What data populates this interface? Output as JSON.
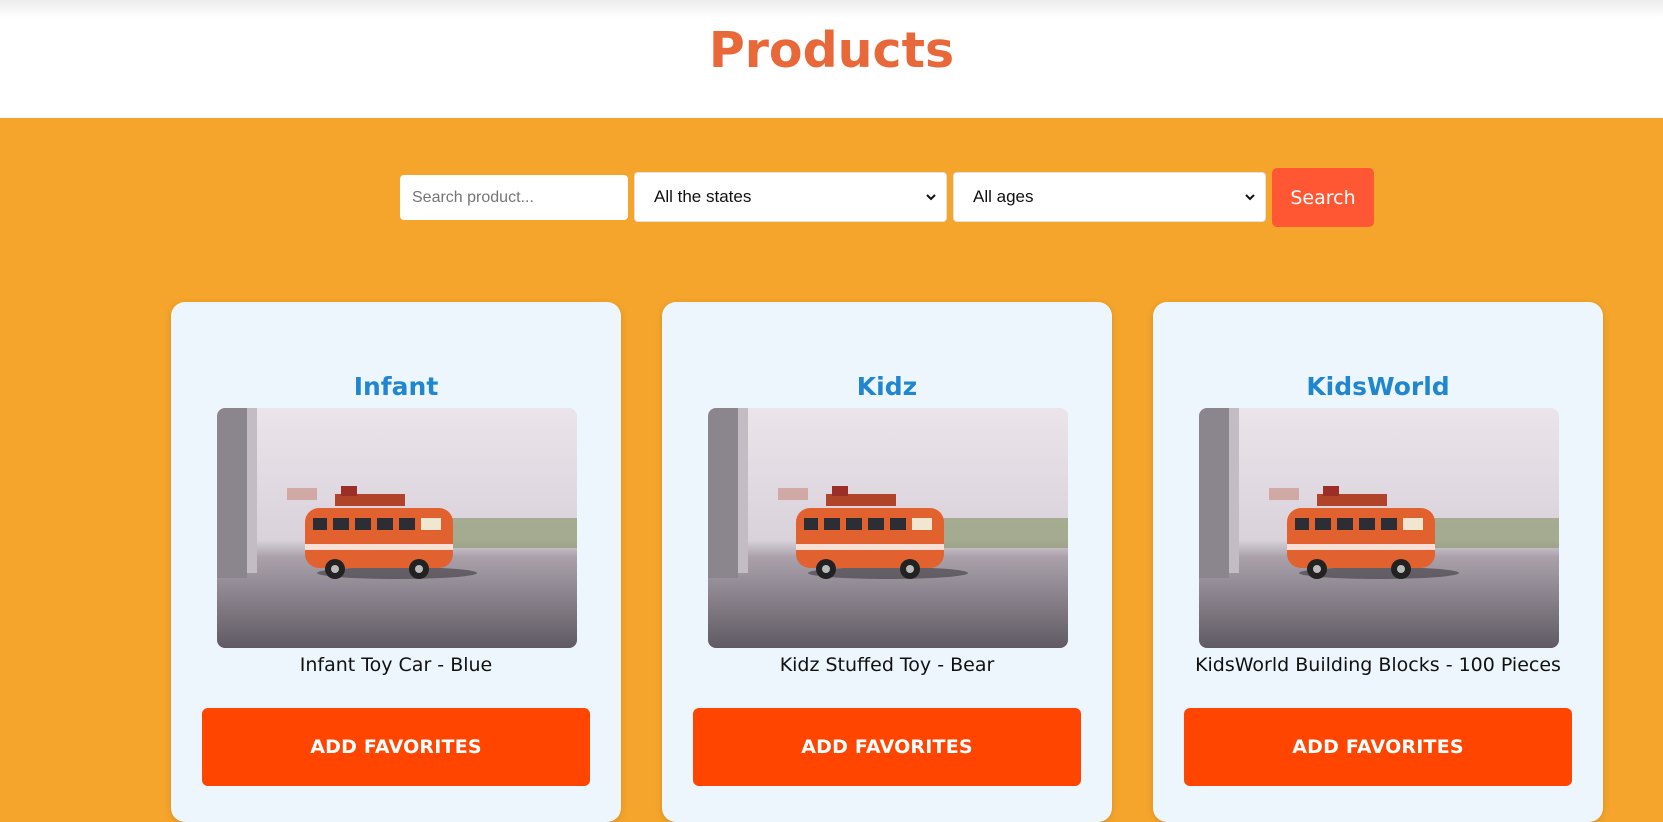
{
  "header": {
    "title": "Products"
  },
  "filters": {
    "search_placeholder": "Search product...",
    "state_selected": "All the states",
    "age_selected": "All ages",
    "search_label": "Search"
  },
  "products": [
    {
      "brand": "Infant",
      "name": "Infant Toy Car - Blue",
      "button_label": "ADD FAVORITES"
    },
    {
      "brand": "Kidz",
      "name": "Kidz Stuffed Toy - Bear",
      "button_label": "ADD FAVORITES"
    },
    {
      "brand": "KidsWorld",
      "name": "KidsWorld Building Blocks - 100 Pieces",
      "button_label": "ADD FAVORITES"
    }
  ],
  "colors": {
    "page_background": "#f5a52b",
    "title": "#e8683a",
    "brand": "#1f86cf",
    "search_button": "#ff5733",
    "favorite_button": "#ff4500",
    "card_background": "#edf6fc"
  }
}
